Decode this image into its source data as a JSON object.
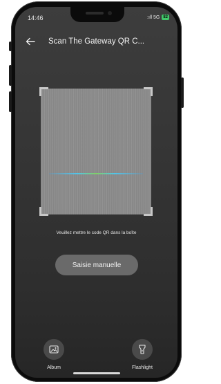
{
  "status_bar": {
    "time": "14:46",
    "signal_text": ":ıll 5G",
    "battery": "82"
  },
  "header": {
    "back_icon": "arrow-left-icon",
    "title": "Scan The Gateway QR C..."
  },
  "scanner": {
    "hint": "Veuillez mettre le code QR dans la boîte"
  },
  "manual_entry": {
    "label": "Saisie manuelle"
  },
  "actions": [
    {
      "label": "Album",
      "icon": "image-icon"
    },
    {
      "label": "Flashlight",
      "icon": "flashlight-icon"
    }
  ],
  "colors": {
    "battery": "#41c96a",
    "scan_line": "#55d4ff",
    "button_bg": "#6a6a6a"
  }
}
